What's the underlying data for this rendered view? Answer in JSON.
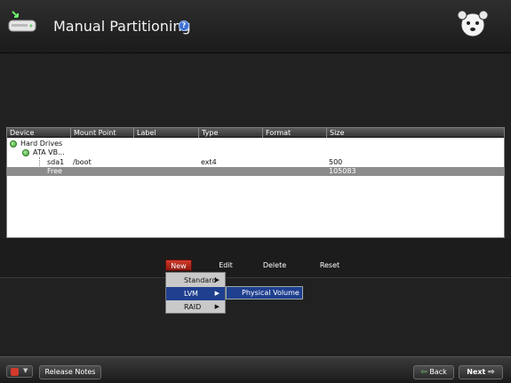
{
  "header": {
    "title": "Manual Partitioning",
    "help_glyph": "?"
  },
  "table": {
    "columns": [
      "Device",
      "Mount Point",
      "Label",
      "Type",
      "Format",
      "Size"
    ],
    "rows": [
      {
        "device": "Hard Drives",
        "mount": "",
        "label": "",
        "type": "",
        "format": "",
        "size": ""
      },
      {
        "device": "ATA VB...",
        "mount": "",
        "label": "",
        "type": "",
        "format": "",
        "size": ""
      },
      {
        "device": "sda1",
        "mount": "/boot",
        "label": "",
        "type": "ext4",
        "format": "",
        "size": "500"
      },
      {
        "device": "Free",
        "mount": "",
        "label": "",
        "type": "",
        "format": "",
        "size": "105083"
      }
    ]
  },
  "actions": {
    "new": "New",
    "edit": "Edit",
    "delete": "Delete",
    "reset": "Reset"
  },
  "new_menu": {
    "items": [
      "Standard",
      "LVM",
      "RAID"
    ],
    "active_index": 1,
    "submenu": "Physical Volume"
  },
  "footer": {
    "release_notes": "Release Notes",
    "back": "Back",
    "next": "Next"
  },
  "colors": {
    "accent_red": "#c02e20",
    "selection_blue": "#1f3f8f",
    "tree_icon_green": "#4caf40"
  }
}
